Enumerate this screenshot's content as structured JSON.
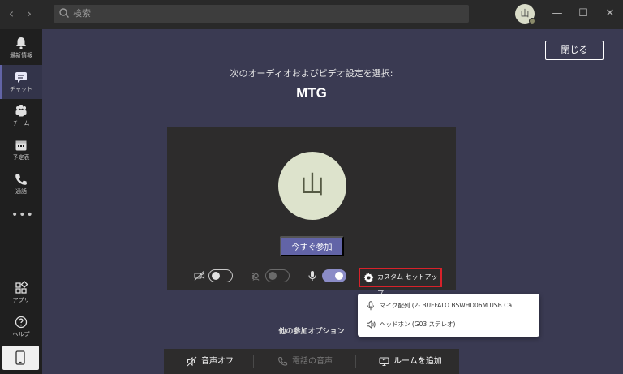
{
  "titlebar": {
    "search_placeholder": "検索",
    "avatar_initial": "山"
  },
  "rail": {
    "items": [
      {
        "label": "最新情報",
        "icon": "bell-icon"
      },
      {
        "label": "チャット",
        "icon": "chat-icon",
        "active": true
      },
      {
        "label": "チーム",
        "icon": "teams-icon"
      },
      {
        "label": "予定表",
        "icon": "calendar-icon"
      },
      {
        "label": "通話",
        "icon": "phone-icon"
      }
    ],
    "more_label": "•••",
    "bottom": [
      {
        "label": "アプリ",
        "icon": "apps-icon"
      },
      {
        "label": "ヘルプ",
        "icon": "help-icon"
      }
    ]
  },
  "main": {
    "close_label": "閉じる",
    "heading": "次のオーディオおよびビデオ設定を選択:",
    "meeting_title": "MTG",
    "avatar_initial": "山",
    "join_label": "今すぐ参加",
    "custom_setup_label": "カスタム セットアップ",
    "toggles": {
      "video": "off",
      "blur": "disabled",
      "mic": "on"
    },
    "devices": [
      {
        "icon": "microphone-icon",
        "label": "マイク配列 (2- BUFFALO BSWHD06M USB Ca..."
      },
      {
        "icon": "speaker-icon",
        "label": "ヘッドホン (G03 ステレオ)"
      }
    ],
    "other_options_label": "他の参加オプション",
    "options": [
      {
        "label": "音声オフ",
        "icon": "speaker-off-icon"
      },
      {
        "label": "電話の音声",
        "icon": "phone-icon",
        "disabled": true
      },
      {
        "label": "ルームを追加",
        "icon": "cast-icon"
      }
    ]
  },
  "colors": {
    "accent": "#6264a7",
    "highlight": "#d8222a",
    "rail": "#1f1f1f",
    "stage": "#3a3a52"
  }
}
